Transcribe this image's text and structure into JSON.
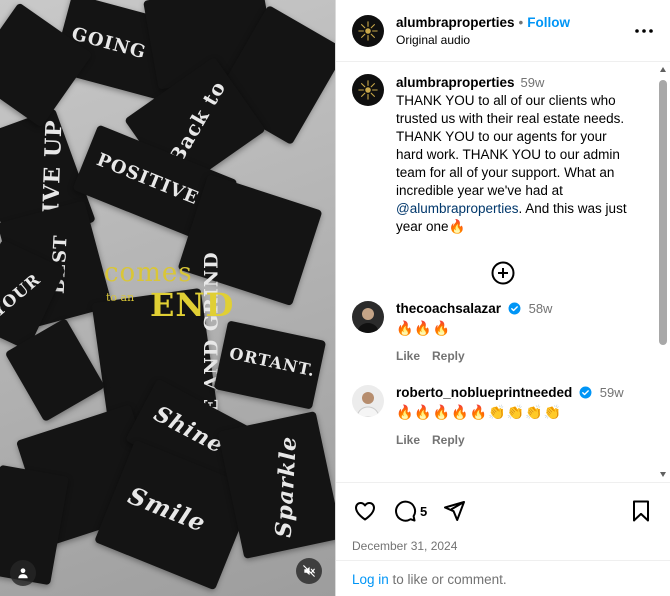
{
  "media": {
    "overlay": {
      "line1": "comes",
      "line2": "to an",
      "line3": "END"
    },
    "stickers": [
      {
        "text": "GIVE UP",
        "deg": -68
      },
      {
        "text": "POSITIVE",
        "deg": 20
      },
      {
        "text": "RISE AND GRIND",
        "deg": -82
      },
      {
        "text": "Back to",
        "deg": -60
      },
      {
        "text": "YOUR",
        "deg": -65
      },
      {
        "text": "Smile",
        "deg": 25
      },
      {
        "text": "Shine",
        "deg": 20
      },
      {
        "text": "Sparkle",
        "deg": -75
      },
      {
        "text": "ORTANT.",
        "deg": -15
      },
      {
        "text": "BEST",
        "deg": -72
      },
      {
        "text": "GOING",
        "deg": 20
      }
    ]
  },
  "header": {
    "username": "alumbraproperties",
    "separator": "•",
    "follow_label": "Follow",
    "audio": "Original audio"
  },
  "caption": {
    "username": "alumbraproperties",
    "time": "59w",
    "text_before": "THANK YOU to all of our clients who trusted us with their real estate needs. THANK YOU to our agents for your hard work. THANK YOU to our admin team for all of your support. What an incredible year we've had at ",
    "mention": "@alumbraproperties",
    "text_after": ". And this was just year one🔥"
  },
  "comments": [
    {
      "username": "thecoachsalazar",
      "time": "58w",
      "text": "🔥🔥🔥",
      "like": "Like",
      "reply": "Reply"
    },
    {
      "username": "roberto_noblueprintneeded",
      "time": "59w",
      "text": "🔥🔥🔥🔥🔥👏👏👏👏",
      "like": "Like",
      "reply": "Reply"
    }
  ],
  "actions": {
    "comment_count": "5",
    "date": "December 31, 2024"
  },
  "login": {
    "link": "Log in",
    "rest": " to like or comment."
  },
  "colors": {
    "accent": "#0095f6",
    "verified": "#0095f6",
    "overlay_text": "#d9c637"
  }
}
